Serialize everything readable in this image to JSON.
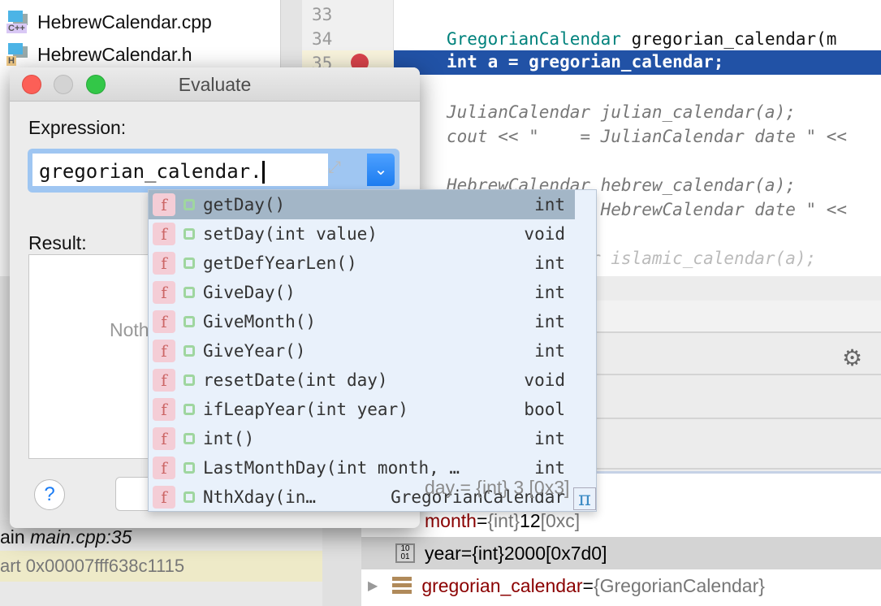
{
  "project": {
    "files": [
      {
        "name": "HebrewCalendar.cpp",
        "tag": "C++"
      },
      {
        "name": "HebrewCalendar.h",
        "tag": "H"
      }
    ]
  },
  "editor": {
    "line_numbers": [
      "33",
      "34",
      "35"
    ],
    "lines": [
      {
        "type": "GregorianCalendar",
        "rest": " gregorian_calendar(m"
      },
      {
        "text": "int a = gregorian_calendar;"
      },
      {
        "text": "JulianCalendar julian_calendar(a);"
      },
      {
        "text": "cout << \"    = JulianCalendar date \" <<"
      },
      {
        "text": "HebrewCalendar hebrew_calendar(a);"
      },
      {
        "text": "cout <<      = HebrewCalendar date \" <<"
      },
      {
        "text": "IslamicCalendar islamic_calendar(a);"
      }
    ]
  },
  "debug": {
    "frame": {
      "func": "ain",
      "file": "main.cpp:35"
    },
    "frame2": "art 0x00007fff638c1115",
    "variables": [
      {
        "name": "day",
        "value": "= {int} 3 [0x3]"
      },
      {
        "name": "month",
        "eq": " = ",
        "type": "{int}",
        "val": " 12 ",
        "hex": "[0xc]"
      },
      {
        "name": "year",
        "eq": " = ",
        "type": "{int}",
        "val": " 2000 ",
        "hex": "[0x7d0]"
      },
      {
        "name": "gregorian_calendar",
        "eq": " = ",
        "type": "{GregorianCalendar}"
      }
    ]
  },
  "dialog": {
    "title": "Evaluate",
    "expression_label": "Expression:",
    "expression_value": "gregorian_calendar.",
    "result_label": "Result:",
    "result_placeholder": "Nothing to show",
    "help": "?"
  },
  "completion": {
    "items": [
      {
        "name": "getDay()",
        "type": "int"
      },
      {
        "name": "setDay(int value)",
        "type": "void"
      },
      {
        "name": "getDefYearLen()",
        "type": "int"
      },
      {
        "name": "GiveDay()",
        "type": "int"
      },
      {
        "name": "GiveMonth()",
        "type": "int"
      },
      {
        "name": "GiveYear()",
        "type": "int"
      },
      {
        "name": "resetDate(int day)",
        "type": "void"
      },
      {
        "name": "ifLeapYear(int year)",
        "type": "bool"
      },
      {
        "name": "int()",
        "type": "int"
      },
      {
        "name": "LastMonthDay(int month, …",
        "type": "int"
      },
      {
        "name": "NthXday(in…",
        "type": "GregorianCalendar"
      }
    ],
    "icon_letter": "f",
    "pi": "π"
  }
}
